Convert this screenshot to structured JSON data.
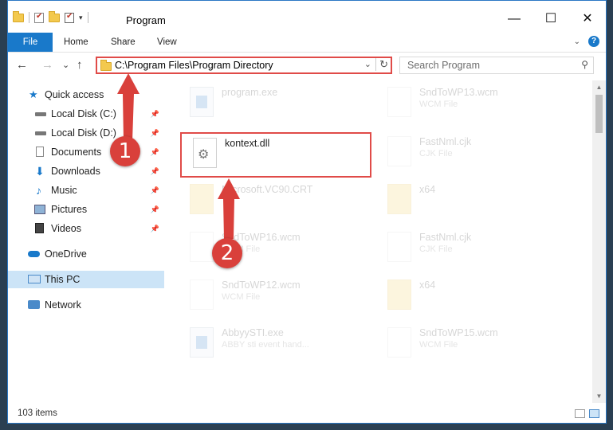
{
  "window": {
    "title": "Program",
    "controls": {
      "minimize": "—",
      "maximize": "☐",
      "close": "✕"
    }
  },
  "ribbon": {
    "tabs": [
      "File",
      "Home",
      "Share",
      "View"
    ],
    "help": "?"
  },
  "nav": {
    "back": "←",
    "forward": "→",
    "recent": "⌄",
    "up": "↑",
    "address": "C:\\Program Files\\Program Directory",
    "search_placeholder": "Search Program"
  },
  "sidebar": {
    "items": [
      {
        "label": "Quick access",
        "icon": "star-icon",
        "pinned": false
      },
      {
        "label": "Local Disk (C:)",
        "icon": "drive-icon",
        "pinned": true
      },
      {
        "label": "Local Disk (D:)",
        "icon": "drive-icon",
        "pinned": true
      },
      {
        "label": "Documents",
        "icon": "documents-icon",
        "pinned": true
      },
      {
        "label": "Downloads",
        "icon": "download-icon",
        "pinned": true
      },
      {
        "label": "Music",
        "icon": "music-icon",
        "pinned": true
      },
      {
        "label": "Pictures",
        "icon": "pictures-icon",
        "pinned": true
      },
      {
        "label": "Videos",
        "icon": "videos-icon",
        "pinned": true
      },
      {
        "label": "OneDrive",
        "icon": "cloud-icon",
        "pinned": false
      },
      {
        "label": "This PC",
        "icon": "computer-icon",
        "pinned": false,
        "selected": true
      },
      {
        "label": "Network",
        "icon": "network-icon",
        "pinned": false
      }
    ]
  },
  "files": [
    {
      "name": "program.exe",
      "type": "",
      "kind": "exe",
      "faded": true
    },
    {
      "name": "SndToWP13.wcm",
      "type": "WCM File",
      "kind": "doc",
      "faded": true
    },
    {
      "name": "kontext.dll",
      "type": "",
      "kind": "dll",
      "faded": false
    },
    {
      "name": "FastNml.cjk",
      "type": "CJK File",
      "kind": "doc",
      "faded": true
    },
    {
      "name": "Microsoft.VC90.CRT",
      "type": "",
      "kind": "folder",
      "faded": true
    },
    {
      "name": "x64",
      "type": "",
      "kind": "folder",
      "faded": true
    },
    {
      "name": "SndToWP16.wcm",
      "type": "WCM File",
      "kind": "doc",
      "faded": true
    },
    {
      "name": "FastNml.cjk",
      "type": "CJK File",
      "kind": "doc",
      "faded": true
    },
    {
      "name": "SndToWP12.wcm",
      "type": "WCM File",
      "kind": "doc",
      "faded": true
    },
    {
      "name": "x64",
      "type": "",
      "kind": "folder",
      "faded": true
    },
    {
      "name": "AbbyySTI.exe",
      "type": "ABBY sti event hand...",
      "kind": "exe",
      "faded": true
    },
    {
      "name": "SndToWP15.wcm",
      "type": "WCM File",
      "kind": "doc",
      "faded": true
    }
  ],
  "status": {
    "items_count": "103 items"
  },
  "callouts": [
    "1",
    "2"
  ],
  "colors": {
    "accent": "#1979ca",
    "highlight": "#e04b48",
    "selected": "#cce4f7"
  }
}
